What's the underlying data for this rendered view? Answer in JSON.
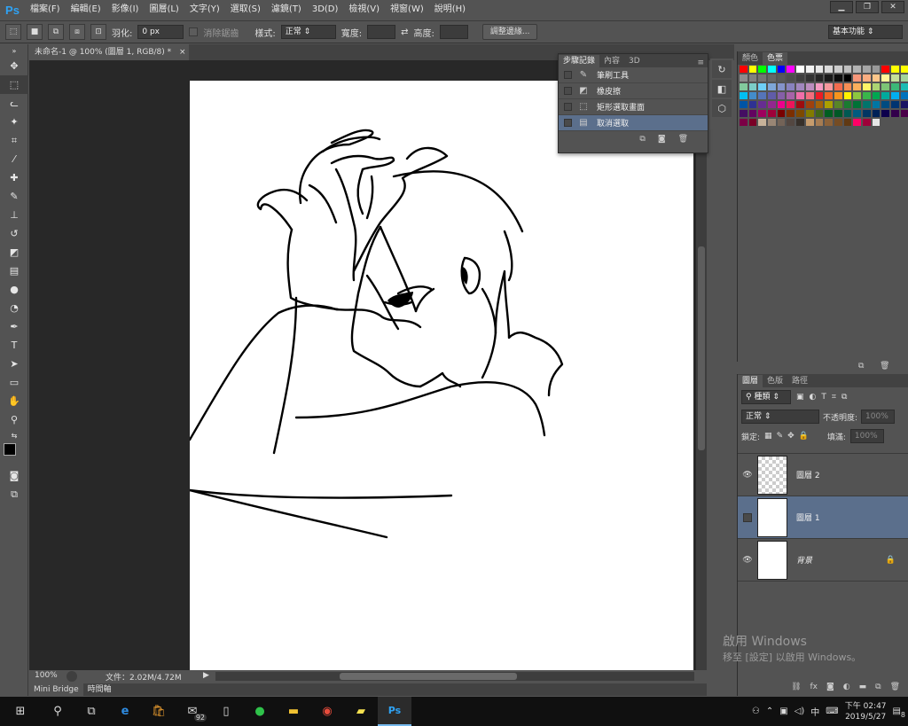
{
  "app": {
    "logo": "Ps"
  },
  "menu": [
    "檔案(F)",
    "編輯(E)",
    "影像(I)",
    "圖層(L)",
    "文字(Y)",
    "選取(S)",
    "濾鏡(T)",
    "3D(D)",
    "檢視(V)",
    "視窗(W)",
    "說明(H)"
  ],
  "window_controls": {
    "minimize": "▁",
    "restore": "❐",
    "close": "✕"
  },
  "options": {
    "feather_label": "羽化:",
    "feather_value": "0 px",
    "antialias_label": "消除鋸齒",
    "style_label": "樣式:",
    "style_value": "正常",
    "width_label": "寬度:",
    "height_label": "高度:",
    "refine_button": "調整邊緣...",
    "workspace": "基本功能"
  },
  "document": {
    "tab_title": "未命名-1 @ 100% (圖層 1, RGB/8) *",
    "close": "×",
    "zoom": "100%",
    "file_info": "文件：2.02M/4.72M"
  },
  "bottom_tabs": [
    "Mini Bridge",
    "時間軸"
  ],
  "history_panel": {
    "tabs": [
      "步驟記錄",
      "內容",
      "3D"
    ],
    "items": [
      {
        "label": "筆刷工具",
        "icon": "✎"
      },
      {
        "label": "橡皮擦",
        "icon": "◩"
      },
      {
        "label": "矩形選取畫面",
        "icon": "⬚"
      },
      {
        "label": "取消選取",
        "icon": "▤"
      }
    ],
    "selected_index": 3
  },
  "swatches_panel": {
    "tabs": [
      "顏色",
      "色票"
    ],
    "colors": [
      "#ff0000",
      "#ffff00",
      "#00ff00",
      "#00ffff",
      "#0000ff",
      "#ff00ff",
      "#ffffff",
      "#f2f2f2",
      "#e6e6e6",
      "#d9d9d9",
      "#cccccc",
      "#bfbfbf",
      "#b3b3b3",
      "#a6a6a6",
      "#999999",
      "#ff0000",
      "#ffff00",
      "#ffff00",
      "#8c8c8c",
      "#808080",
      "#737373",
      "#666666",
      "#595959",
      "#4d4d4d",
      "#404040",
      "#333333",
      "#262626",
      "#1a1a1a",
      "#0d0d0d",
      "#000000",
      "#f7977a",
      "#f9ad81",
      "#fdc68a",
      "#fff79a",
      "#c4df9b",
      "#a2d39c",
      "#82ca9d",
      "#7bcdc8",
      "#6ecff6",
      "#7ea7d8",
      "#8493ca",
      "#8882be",
      "#a187be",
      "#bc8dbf",
      "#f49ac2",
      "#f6989d",
      "#f26c4f",
      "#f68e55",
      "#fbaf5c",
      "#fff467",
      "#acd372",
      "#7cc576",
      "#3bb878",
      "#1abbb4",
      "#00bff3",
      "#438ccb",
      "#5574b9",
      "#605ca8",
      "#855fa8",
      "#a763a8",
      "#f06ea9",
      "#f26d7d",
      "#ed1c24",
      "#f26522",
      "#f7941d",
      "#fff200",
      "#8dc73f",
      "#39b54a",
      "#00a651",
      "#00a99d",
      "#00aeef",
      "#0072bc",
      "#0054a6",
      "#2e3192",
      "#662d91",
      "#92278f",
      "#ec008c",
      "#ed145b",
      "#9e0b0f",
      "#a0410d",
      "#a36209",
      "#aba000",
      "#598527",
      "#1a7b30",
      "#007236",
      "#00746b",
      "#0076a3",
      "#004b80",
      "#003471",
      "#1b1464",
      "#440e62",
      "#630460",
      "#9e005d",
      "#9e0039",
      "#790000",
      "#7b2e00",
      "#7d4900",
      "#827b00",
      "#406618",
      "#005e20",
      "#005826",
      "#005952",
      "#005b7f",
      "#003663",
      "#002157",
      "#0d004c",
      "#32004b",
      "#4b0049",
      "#7b0046",
      "#7a0026",
      "#c7b299",
      "#998675",
      "#736357",
      "#534741",
      "#37302a",
      "#c69c6d",
      "#a67c52",
      "#8c6239",
      "#754c24",
      "#603913",
      "#ff0066",
      "#9e0039",
      "#e6e6e6"
    ]
  },
  "layers_panel": {
    "tabs": [
      "圖層",
      "色版",
      "路徑"
    ],
    "filter": "種類",
    "blend": "正常",
    "opacity_label": "不透明度:",
    "opacity": "100%",
    "lock_label": "鎖定:",
    "fill_label": "填滿:",
    "fill": "100%",
    "layers": [
      {
        "name": "圖層 2",
        "visible": true,
        "selected": false
      },
      {
        "name": "圖層 1",
        "visible": false,
        "selected": true
      },
      {
        "name": "背景",
        "visible": true,
        "selected": false
      }
    ]
  },
  "watermark": {
    "title": "啟用 Windows",
    "subtitle": "移至 [設定] 以啟用 Windows。"
  },
  "taskbar": {
    "mail_badge": "92",
    "time": "下午 02:47",
    "date": "2019/5/27",
    "notif": "8",
    "ime": "中"
  }
}
